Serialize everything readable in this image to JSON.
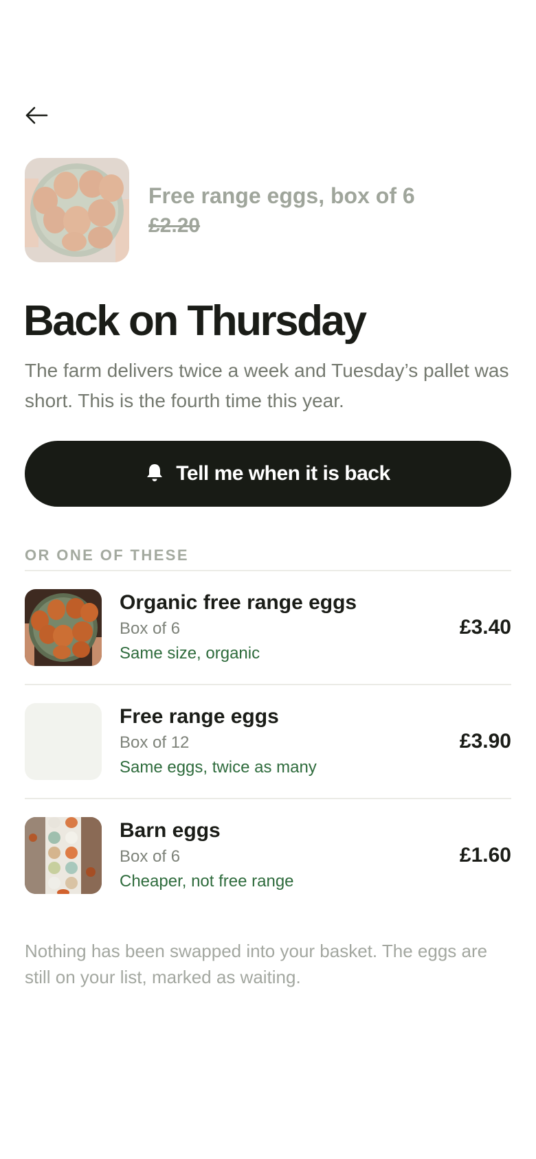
{
  "nav": {
    "back_icon": "arrow-left-icon"
  },
  "product": {
    "title": "Free range eggs, box of 6",
    "price": "£2.20",
    "status": "unavailable"
  },
  "headline": "Back on Thursday",
  "description": "The farm delivers twice a week and Tuesday’s pallet was short. This is the fourth time this year.",
  "notify_button": {
    "label": "Tell me when it is back",
    "icon": "bell-icon"
  },
  "alternatives": {
    "label": "OR ONE OF THESE",
    "items": [
      {
        "name": "Organic free range eggs",
        "size": "Box of 6",
        "note": "Same size, organic",
        "price": "£3.40"
      },
      {
        "name": "Free range eggs",
        "size": "Box of 12",
        "note": "Same eggs, twice as many",
        "price": "£3.90"
      },
      {
        "name": "Barn eggs",
        "size": "Box of 6",
        "note": "Cheaper, not free range",
        "price": "£1.60"
      }
    ]
  },
  "footnote": "Nothing has been swapped into your basket. The eggs are still on your list, marked as waiting.",
  "colors": {
    "accent_dark": "#181b15",
    "note_green": "#2e6b3c",
    "muted_text": "#74796f"
  }
}
